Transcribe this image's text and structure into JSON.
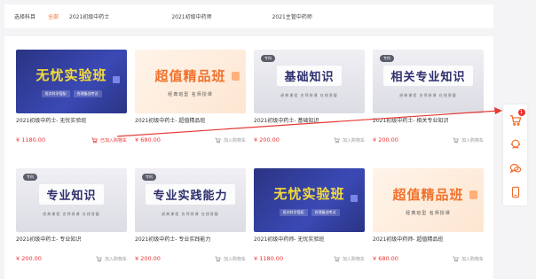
{
  "filter": {
    "label": "选择科目",
    "options": [
      "全部",
      "2021初级中药士",
      "2021初级中药师",
      "2021主管中药师"
    ]
  },
  "courses": [
    {
      "banner": {
        "theme": "navy",
        "headline": "无忧实验班",
        "chips": [
          "班次科学搭配",
          "合理备战考试"
        ]
      },
      "title": "2021初级中药士- 无忧实验班",
      "price": "¥ 1180.00",
      "cart": "已加入购物车",
      "added": true
    },
    {
      "banner": {
        "theme": "peach",
        "headline": "超值精品班",
        "sub": "经典班型 名师授课"
      },
      "title": "2021初级中药士- 超值精品班",
      "price": "¥ 680.00",
      "cart": "加入购物车",
      "added": false
    },
    {
      "banner": {
        "theme": "gray",
        "tag": "专科",
        "headline": "基础知识",
        "sub": "经典课程 名师授课 在线答疑"
      },
      "title": "2021初级中药士- 基础知识",
      "price": "¥ 200.00",
      "cart": "加入购物车",
      "added": false
    },
    {
      "banner": {
        "theme": "gray",
        "tag": "专科",
        "headline": "相关专业知识",
        "sub": "经典课程 名师授课 在线答疑"
      },
      "title": "2021初级中药士- 相关专业知识",
      "price": "¥ 200.00",
      "cart": "加入购物车",
      "added": false
    },
    {
      "banner": {
        "theme": "gray",
        "tag": "专科",
        "headline": "专业知识",
        "sub": "经典课程 名师授课 在线答疑"
      },
      "title": "2021初级中药士- 专业知识",
      "price": "¥ 200.00",
      "cart": "加入购物车",
      "added": false
    },
    {
      "banner": {
        "theme": "gray",
        "tag": "专科",
        "headline": "专业实践能力",
        "sub": "经典课程 名师授课 在线答疑"
      },
      "title": "2021初级中药士- 专业实践能力",
      "price": "¥ 200.00",
      "cart": "加入购物车",
      "added": false
    },
    {
      "banner": {
        "theme": "navy",
        "headline": "无忧实验班",
        "chips": [
          "班次科学搭配",
          "合理备战考试"
        ]
      },
      "title": "2021初级中药师- 无忧实验班",
      "price": "¥ 1180.00",
      "cart": "加入购物车",
      "added": false
    },
    {
      "banner": {
        "theme": "peach",
        "headline": "超值精品班",
        "sub": "经典班型 名师授课"
      },
      "title": "2021初级中药师- 超值精品班",
      "price": "¥ 680.00",
      "cart": "加入购物车",
      "added": false
    }
  ],
  "sidebar": {
    "icons": [
      "cart-icon",
      "service-icon",
      "chat-icon",
      "phone-icon"
    ],
    "cart_badge": "1"
  },
  "colors": {
    "accent": "#f26b2a",
    "price": "#e33333",
    "arrow": "#e53935"
  }
}
